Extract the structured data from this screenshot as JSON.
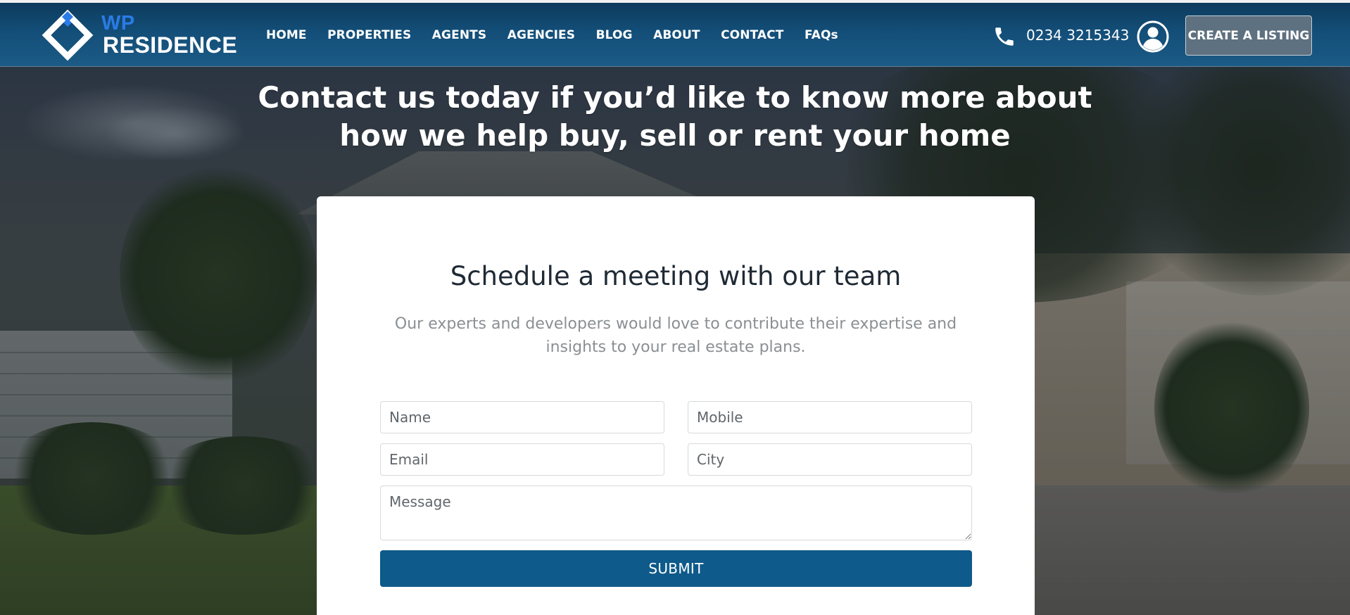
{
  "header": {
    "logo": {
      "top_text": "WP",
      "bottom_text": "RESIDENCE"
    },
    "nav": [
      {
        "label": "HOME"
      },
      {
        "label": "PROPERTIES"
      },
      {
        "label": "AGENTS"
      },
      {
        "label": "AGENCIES"
      },
      {
        "label": "BLOG"
      },
      {
        "label": "ABOUT"
      },
      {
        "label": "CONTACT"
      },
      {
        "label": "FAQs"
      }
    ],
    "phone": {
      "icon": "phone-icon",
      "number": "0234 3215343"
    },
    "user": {
      "icon": "user-account-icon"
    },
    "cta_label": "CREATE A LISTING"
  },
  "hero": {
    "title_line1": "Contact us today if you’d like to know more about",
    "title_line2": "how we help buy, sell or rent your home"
  },
  "form": {
    "title": "Schedule a meeting with our team",
    "subtitle_line1": "Our experts and developers would love to contribute their expertise and",
    "subtitle_line2": "insights to your real estate plans.",
    "name_placeholder": "Name",
    "mobile_placeholder": "Mobile",
    "email_placeholder": "Email",
    "city_placeholder": "City",
    "message_placeholder": "Message",
    "submit_label": "SUBMIT"
  },
  "colors": {
    "header_bg": "#134e78",
    "logo_accent": "#2a7be6",
    "submit_bg": "#0e5a8a",
    "cta_bg": "#5e7180"
  }
}
